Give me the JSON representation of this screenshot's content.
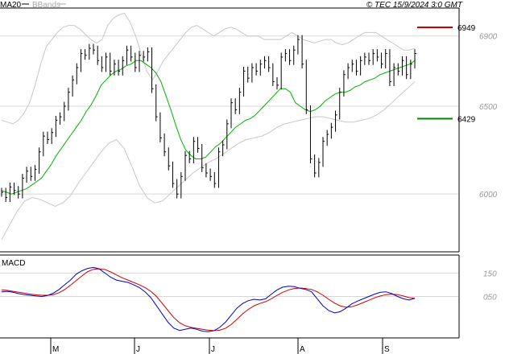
{
  "header": {
    "ma_label": "MA20",
    "bb_label": "BBands",
    "timestamp": "© TEC 15/9/2024 3:0 GMT"
  },
  "colors": {
    "ma": "#00b000",
    "bands": "#c8c8c8",
    "price": "#000000",
    "macd": "#0000cc",
    "signal": "#cc0000",
    "resistance": "#cc0000",
    "support": "#008800",
    "grid": "#d8d8d8",
    "border": "#000000"
  },
  "chart_data": [
    {
      "type": "ohlc",
      "x_labels": [
        "M",
        "J",
        "J",
        "A",
        "S"
      ],
      "y_ticks": [
        6000,
        6500,
        6900
      ],
      "y_tick_labels": [
        "6000",
        "6500",
        "6900"
      ],
      "ylim": [
        5680,
        7050
      ],
      "grid": "horizontal",
      "levels": [
        {
          "name": "resistance",
          "value": 6949,
          "label": "6949"
        },
        {
          "name": "support",
          "value": 6429,
          "label": "6429"
        }
      ],
      "close": [
        6010,
        5980,
        6040,
        6020,
        6000,
        6090,
        6130,
        6100,
        6140,
        6240,
        6330,
        6310,
        6350,
        6420,
        6440,
        6500,
        6580,
        6650,
        6720,
        6800,
        6790,
        6830,
        6820,
        6760,
        6720,
        6780,
        6700,
        6740,
        6700,
        6760,
        6820,
        6780,
        6720,
        6790,
        6780,
        6810,
        6600,
        6440,
        6320,
        6240,
        6160,
        6060,
        6000,
        6100,
        6220,
        6200,
        6300,
        6260,
        6150,
        6120,
        6100,
        6060,
        6240,
        6280,
        6400,
        6520,
        6480,
        6580,
        6700,
        6660,
        6720,
        6700,
        6740,
        6760,
        6720,
        6640,
        6620,
        6780,
        6800,
        6760,
        6820,
        6880,
        6740,
        6480,
        6200,
        6120,
        6180,
        6300,
        6340,
        6380,
        6450,
        6580,
        6680,
        6720,
        6740,
        6700,
        6760,
        6780,
        6760,
        6800,
        6780,
        6740,
        6800,
        6640,
        6720,
        6700,
        6760,
        6680,
        6740,
        6800
      ],
      "ma20": [
        6020,
        6010,
        6000,
        6010,
        6020,
        6030,
        6050,
        6070,
        6090,
        6130,
        6170,
        6220,
        6260,
        6300,
        6340,
        6380,
        6420,
        6470,
        6510,
        6560,
        6620,
        6650,
        6680,
        6700,
        6710,
        6730,
        6740,
        6760,
        6760,
        6740,
        6720,
        6690,
        6640,
        6560,
        6480,
        6390,
        6310,
        6250,
        6220,
        6200,
        6200,
        6210,
        6240,
        6270,
        6290,
        6320,
        6350,
        6380,
        6400,
        6420,
        6430,
        6450,
        6480,
        6510,
        6540,
        6570,
        6600,
        6600,
        6580,
        6520,
        6500,
        6480,
        6470,
        6480,
        6500,
        6530,
        6550,
        6570,
        6580,
        6580,
        6590,
        6610,
        6620,
        6640,
        6650,
        6660,
        6680,
        6690,
        6700,
        6710,
        6720,
        6730,
        6740,
        6760
      ],
      "bb_upper": [
        6420,
        6410,
        6400,
        6420,
        6460,
        6520,
        6620,
        6740,
        6840,
        6880,
        6920,
        6950,
        6960,
        6960,
        6940,
        6910,
        6880,
        6860,
        6880,
        6960,
        7000,
        7020,
        7030,
        6980,
        6900,
        6800,
        6700,
        6650,
        6700,
        6760,
        6800,
        6840,
        6880,
        6920,
        6950,
        6960,
        6940,
        6920,
        6900,
        6920,
        6940,
        6950,
        6940,
        6920,
        6900,
        6900,
        6900,
        6880,
        6880,
        6880,
        6880,
        6900,
        6920,
        6900,
        6880,
        6870,
        6860,
        6870,
        6880,
        6880,
        6860,
        6850,
        6860,
        6880,
        6900,
        6920,
        6920,
        6920,
        6900,
        6880,
        6860,
        6840,
        6820,
        6820,
        6830
      ],
      "bb_lower": [
        5740,
        5820,
        5900,
        5960,
        5980,
        5970,
        5950,
        5930,
        5950,
        5990,
        6060,
        6120,
        6180,
        6240,
        6290,
        6310,
        6260,
        6160,
        6050,
        5980,
        5950,
        5960,
        6000,
        6040,
        6080,
        6120,
        6150,
        6180,
        6200,
        6230,
        6260,
        6290,
        6310,
        6320,
        6330,
        6350,
        6380,
        6400,
        6410,
        6420,
        6430,
        6440,
        6440,
        6430,
        6420,
        6410,
        6410,
        6420,
        6430,
        6450,
        6480,
        6520,
        6560,
        6600,
        6640
      ]
    },
    {
      "type": "line",
      "title": "MACD",
      "x_labels": [
        "M",
        "J",
        "J",
        "A",
        "S"
      ],
      "y_ticks": [
        150,
        50
      ],
      "y_tick_labels": [
        "150",
        "050"
      ],
      "ylim": [
        -120,
        220
      ],
      "series": [
        {
          "values": [
            70,
            72,
            68,
            62,
            58,
            55,
            52,
            50,
            54,
            64,
            80,
            100,
            120,
            145,
            160,
            170,
            174,
            168,
            150,
            132,
            120,
            115,
            110,
            100,
            88,
            70,
            45,
            10,
            -25,
            -60,
            -85,
            -95,
            -90,
            -85,
            -90,
            -98,
            -100,
            -96,
            -82,
            -60,
            -30,
            0,
            20,
            32,
            38,
            35,
            40,
            60,
            78,
            90,
            94,
            92,
            85,
            80,
            70,
            40,
            10,
            -10,
            -20,
            -15,
            0,
            18,
            30,
            40,
            50,
            60,
            68,
            70,
            62,
            50,
            40,
            35,
            42
          ]
        },
        {
          "values": [
            78,
            76,
            72,
            68,
            64,
            60,
            57,
            55,
            55,
            58,
            66,
            80,
            98,
            118,
            138,
            156,
            166,
            168,
            165,
            155,
            142,
            130,
            120,
            110,
            100,
            88,
            72,
            50,
            20,
            -10,
            -40,
            -62,
            -75,
            -82,
            -86,
            -90,
            -94,
            -96,
            -94,
            -86,
            -70,
            -48,
            -24,
            -5,
            10,
            20,
            28,
            40,
            55,
            68,
            78,
            84,
            86,
            84,
            80,
            70,
            55,
            38,
            22,
            10,
            4,
            6,
            14,
            24,
            34,
            44,
            52,
            58,
            60,
            58,
            52,
            45,
            42
          ]
        }
      ]
    }
  ]
}
